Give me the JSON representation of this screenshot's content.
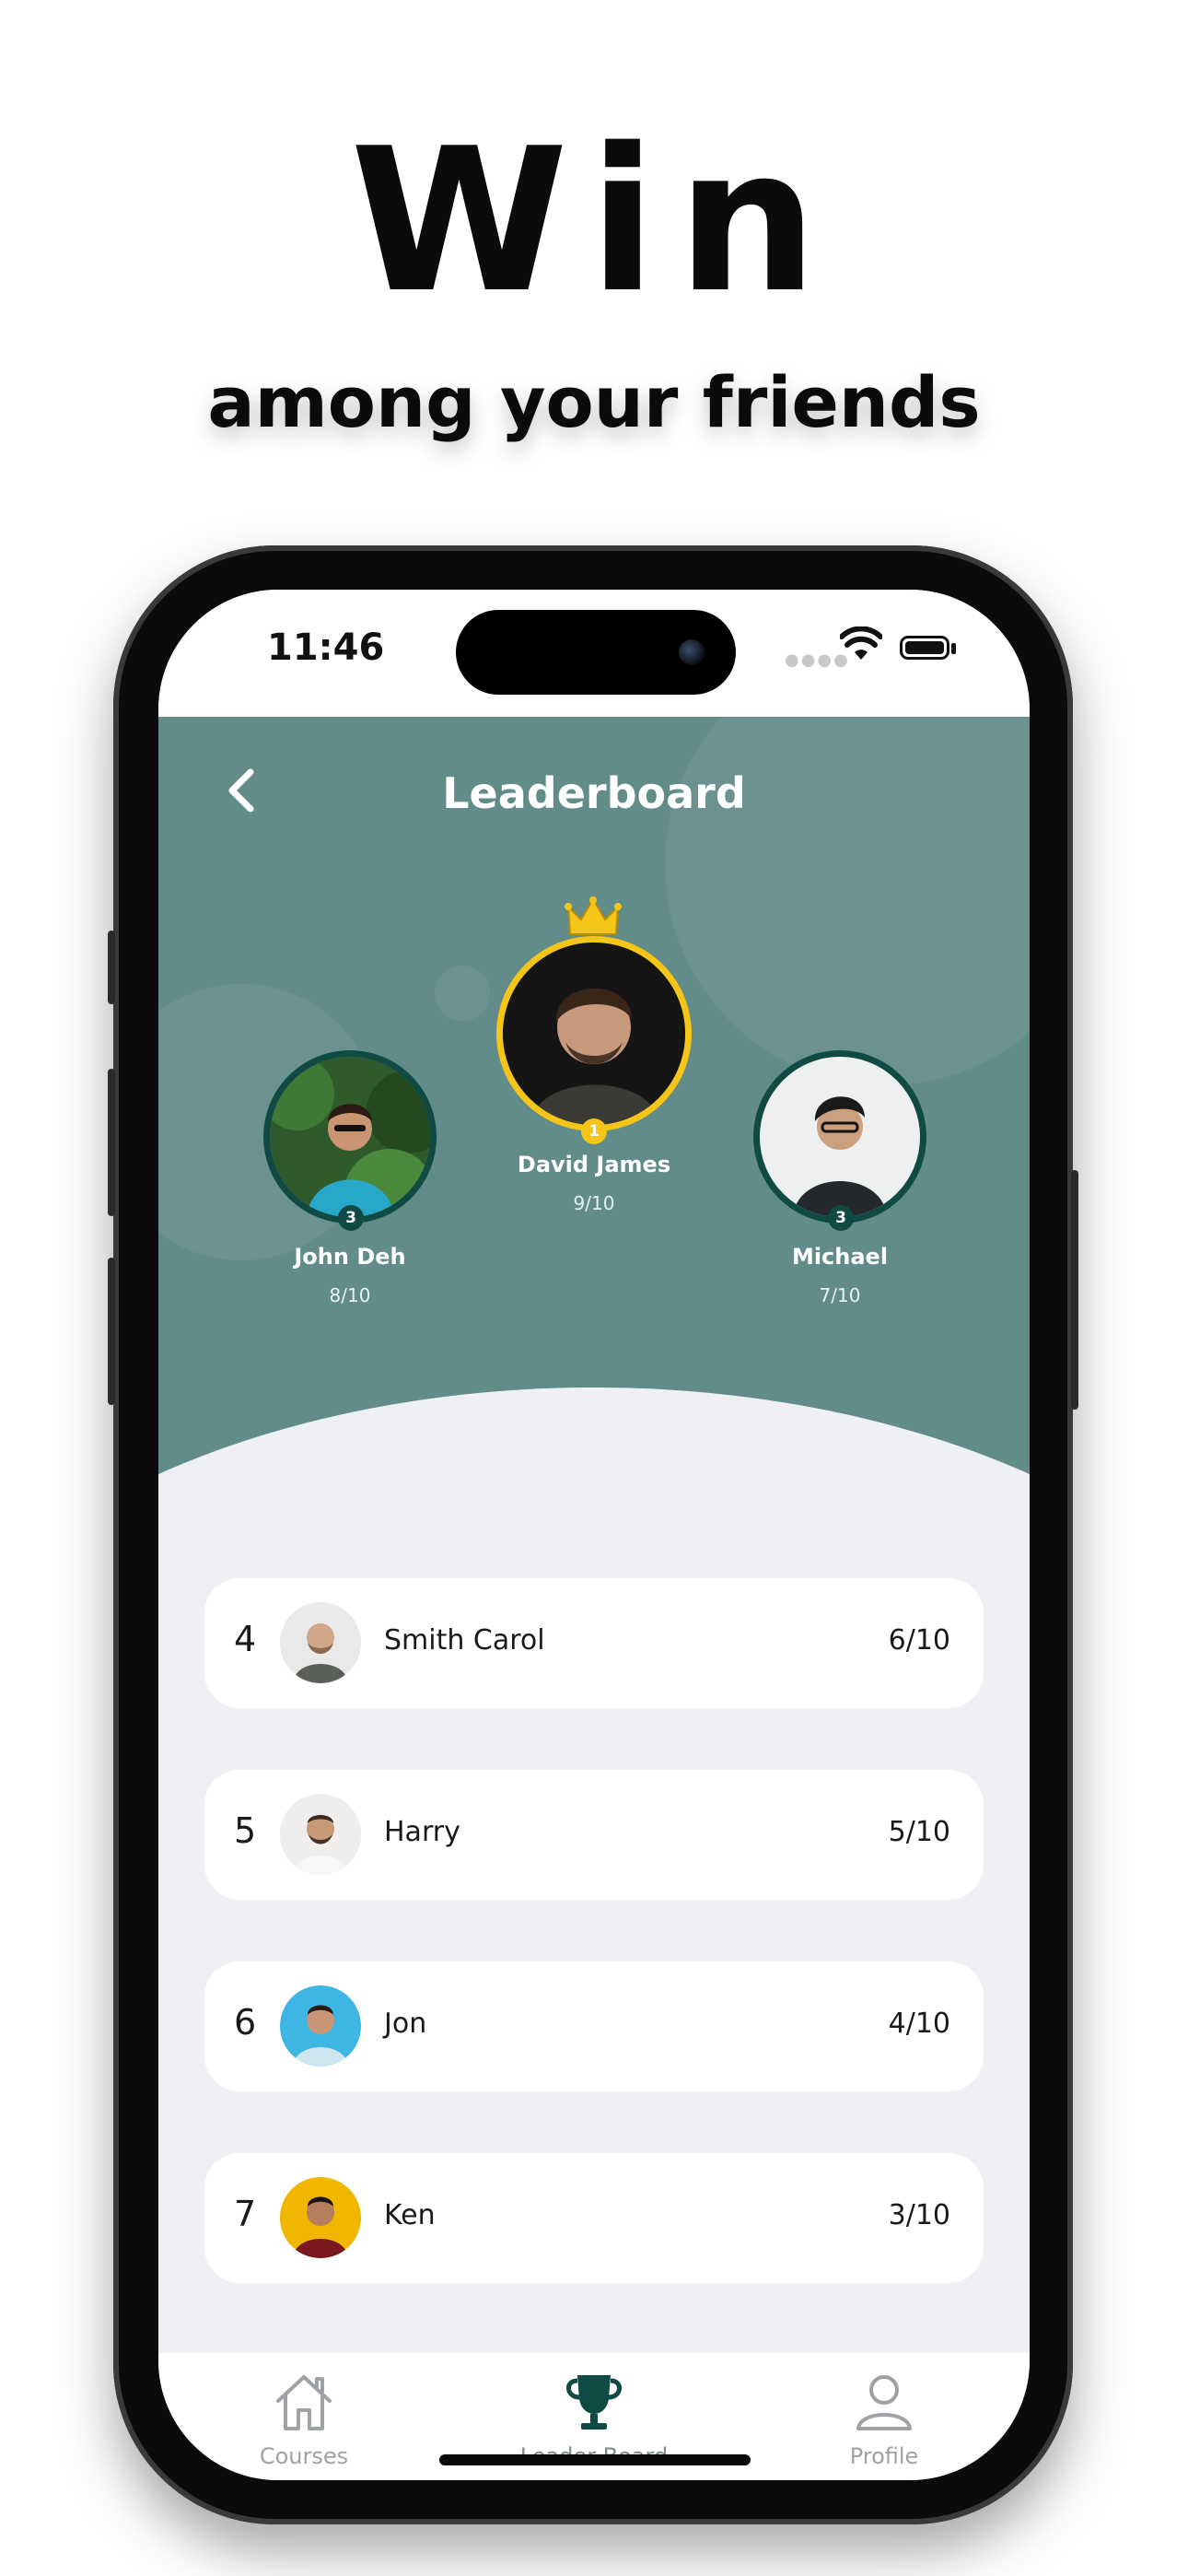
{
  "promo": {
    "headline": "Win",
    "subline": "among your friends"
  },
  "status_bar": {
    "time": "11:46"
  },
  "header": {
    "title": "Leaderboard"
  },
  "podium": [
    {
      "name": "John Deh",
      "score": "8/10",
      "badge": "3",
      "position": "second"
    },
    {
      "name": "David James",
      "score": "9/10",
      "badge": "1",
      "position": "first"
    },
    {
      "name": "Michael",
      "score": "7/10",
      "badge": "3",
      "position": "third"
    }
  ],
  "rows": [
    {
      "rank": "4",
      "name": "Smith Carol",
      "score": "6/10"
    },
    {
      "rank": "5",
      "name": "Harry",
      "score": "5/10"
    },
    {
      "rank": "6",
      "name": "Jon",
      "score": "4/10"
    },
    {
      "rank": "7",
      "name": "Ken",
      "score": "3/10"
    }
  ],
  "tabs": [
    {
      "label": "Courses",
      "icon": "home-icon",
      "active": false
    },
    {
      "label": "Leader Board",
      "icon": "trophy-icon",
      "active": true
    },
    {
      "label": "Profile",
      "icon": "user-icon",
      "active": false
    }
  ],
  "colors": {
    "header_teal": "#628c8a",
    "accent_dark_teal": "#0f4a44",
    "gold": "#f5c518",
    "list_bg": "#eff0f3"
  }
}
